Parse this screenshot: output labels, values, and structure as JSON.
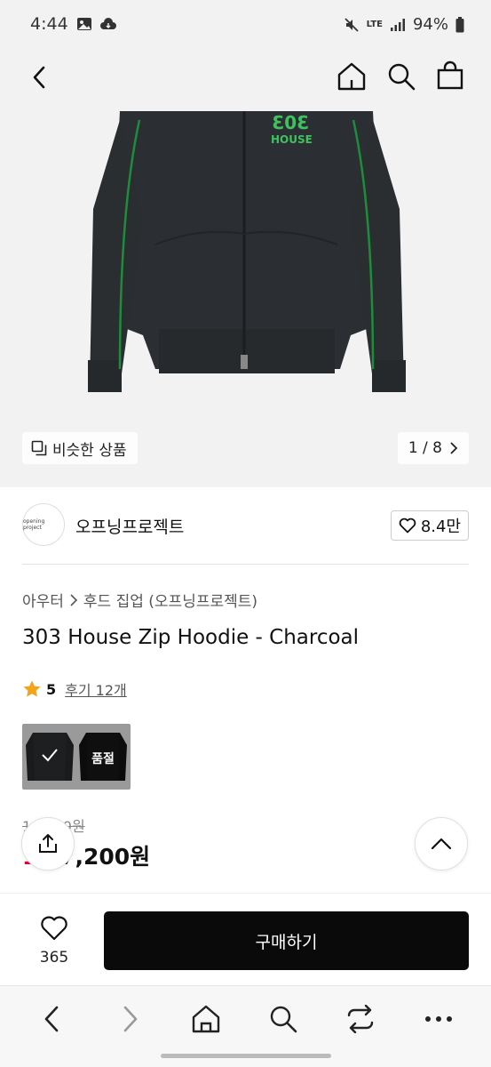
{
  "status": {
    "time": "4:44",
    "network": "LTE",
    "battery": "94%"
  },
  "hero": {
    "similar_label": "비슷한 상품",
    "pager": "1 / 8"
  },
  "brand": {
    "logo_text": "opening project",
    "name": "오프닝프로젝트",
    "likes": "8.4만"
  },
  "breadcrumb": {
    "category": "아우터",
    "subcategory": "후드 집업 (오프닝프로젝트)"
  },
  "product": {
    "title": "303 House Zip Hoodie - Charcoal",
    "print_text": "HOUSE"
  },
  "rating": {
    "score": "5",
    "reviews": "후기 12개"
  },
  "colors": {
    "soldout_label": "품절",
    "accent_green": "#2aa84a"
  },
  "price": {
    "original": "10  000원",
    "discount": "1 ",
    "sale": "97,200원"
  },
  "actions": {
    "wish_count": "365",
    "buy_label": "구매하기"
  },
  "icons": {
    "status": [
      "image-icon",
      "cloud-icon",
      "mute-icon",
      "signal-icon",
      "battery-icon"
    ],
    "nav": [
      "back-icon",
      "home-icon",
      "search-icon",
      "bag-icon"
    ],
    "browser": [
      "back-icon",
      "forward-icon",
      "home-icon",
      "search-icon",
      "tabs-icon",
      "more-icon"
    ]
  }
}
